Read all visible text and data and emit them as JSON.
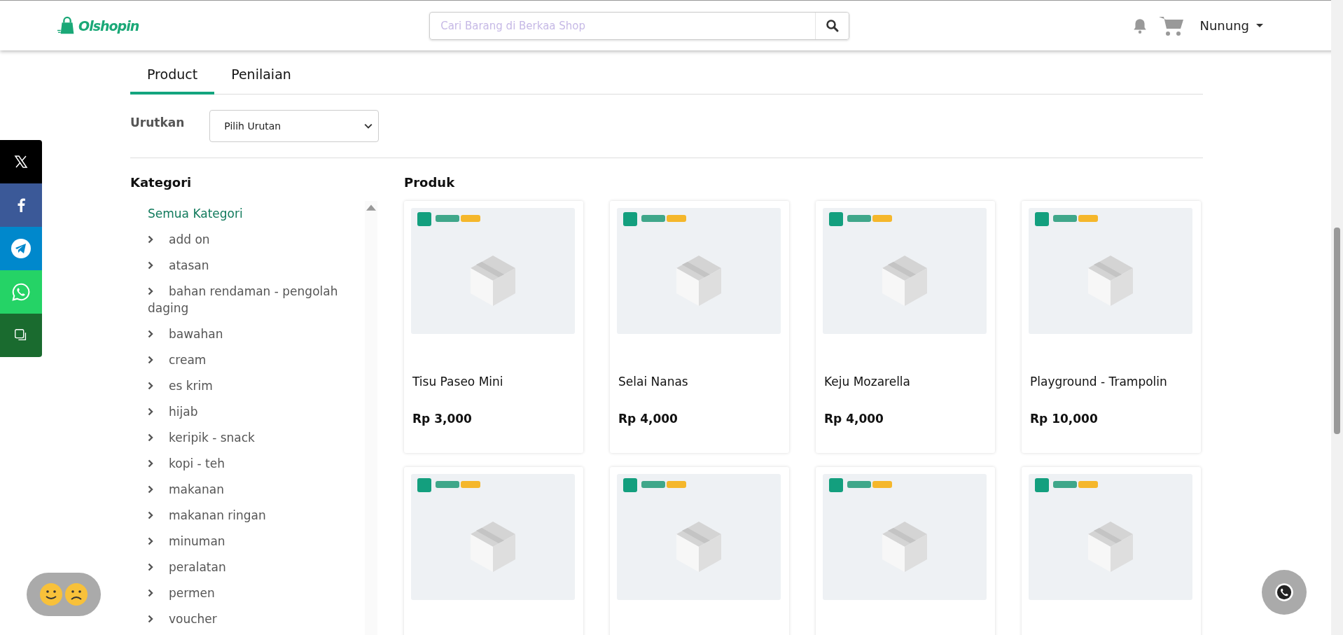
{
  "header": {
    "brand": "Olshopin",
    "search": {
      "placeholder": "Cari Barang di Berkaa Shop"
    },
    "user": "Nunung"
  },
  "tabs": [
    {
      "label": "Product",
      "selected": true
    },
    {
      "label": "Penilaian",
      "selected": false
    }
  ],
  "sort": {
    "label": "Urutkan",
    "value": "Pilih Urutan"
  },
  "categories": {
    "title": "Kategori",
    "all": "Semua Kategori",
    "items": [
      "add on",
      "atasan",
      "bahan rendaman - pengolah daging",
      "bawahan",
      "cream",
      "es krim",
      "hijab",
      "keripik - snack",
      "kopi - teh",
      "makanan",
      "makanan ringan",
      "minuman",
      "peralatan",
      "permen",
      "voucher"
    ]
  },
  "products": {
    "title": "Produk",
    "items": [
      {
        "kind": "product",
        "name": "Tisu Paseo Mini",
        "price": "Rp 3,000"
      },
      {
        "kind": "product",
        "name": "Selai Nanas",
        "price": "Rp 4,000"
      },
      {
        "kind": "product",
        "name": "Keju Mozarella",
        "price": "Rp 4,000"
      },
      {
        "kind": "product",
        "name": "Playground - Trampolin",
        "price": "Rp 10,000"
      },
      {
        "kind": "picture"
      },
      {
        "kind": "picture"
      },
      {
        "kind": "picture"
      },
      {
        "kind": "picture"
      }
    ]
  },
  "share": [
    {
      "kind": "x"
    },
    {
      "kind": "facebook"
    },
    {
      "kind": "telegram"
    },
    {
      "kind": "whatsapp"
    },
    {
      "kind": "copy"
    }
  ]
}
